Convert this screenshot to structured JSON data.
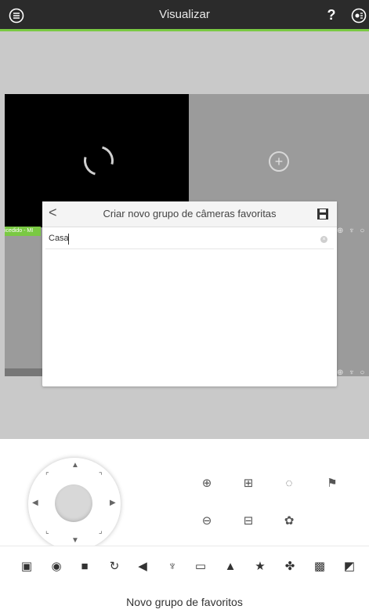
{
  "header": {
    "title": "Visualizar",
    "help_label": "?"
  },
  "grid": {
    "strip_label": "icedido - MI"
  },
  "dialog": {
    "title": "Criar novo grupo de câmeras favoritas",
    "input_value": "Casa",
    "back_label": "<",
    "save_icon": "save-icon"
  },
  "controls": {
    "icons": [
      "zoom-in-icon",
      "focus-near-icon",
      "iris-open-icon",
      "flag-icon",
      "zoom-out-icon",
      "focus-far-icon",
      "iris-close-icon"
    ]
  },
  "toolbar": {
    "icons": [
      "remove-device-icon",
      "snapshot-icon",
      "record-icon",
      "playback-icon",
      "mute-icon",
      "microphone-icon",
      "display-icon",
      "alarm-icon",
      "favorite-icon",
      "fan-icon",
      "close-all-icon",
      "fullscreen-icon"
    ]
  },
  "caption": "Novo grupo de favoritos",
  "colors": {
    "accent": "#7ac943",
    "topbar": "#2b2b2b"
  }
}
